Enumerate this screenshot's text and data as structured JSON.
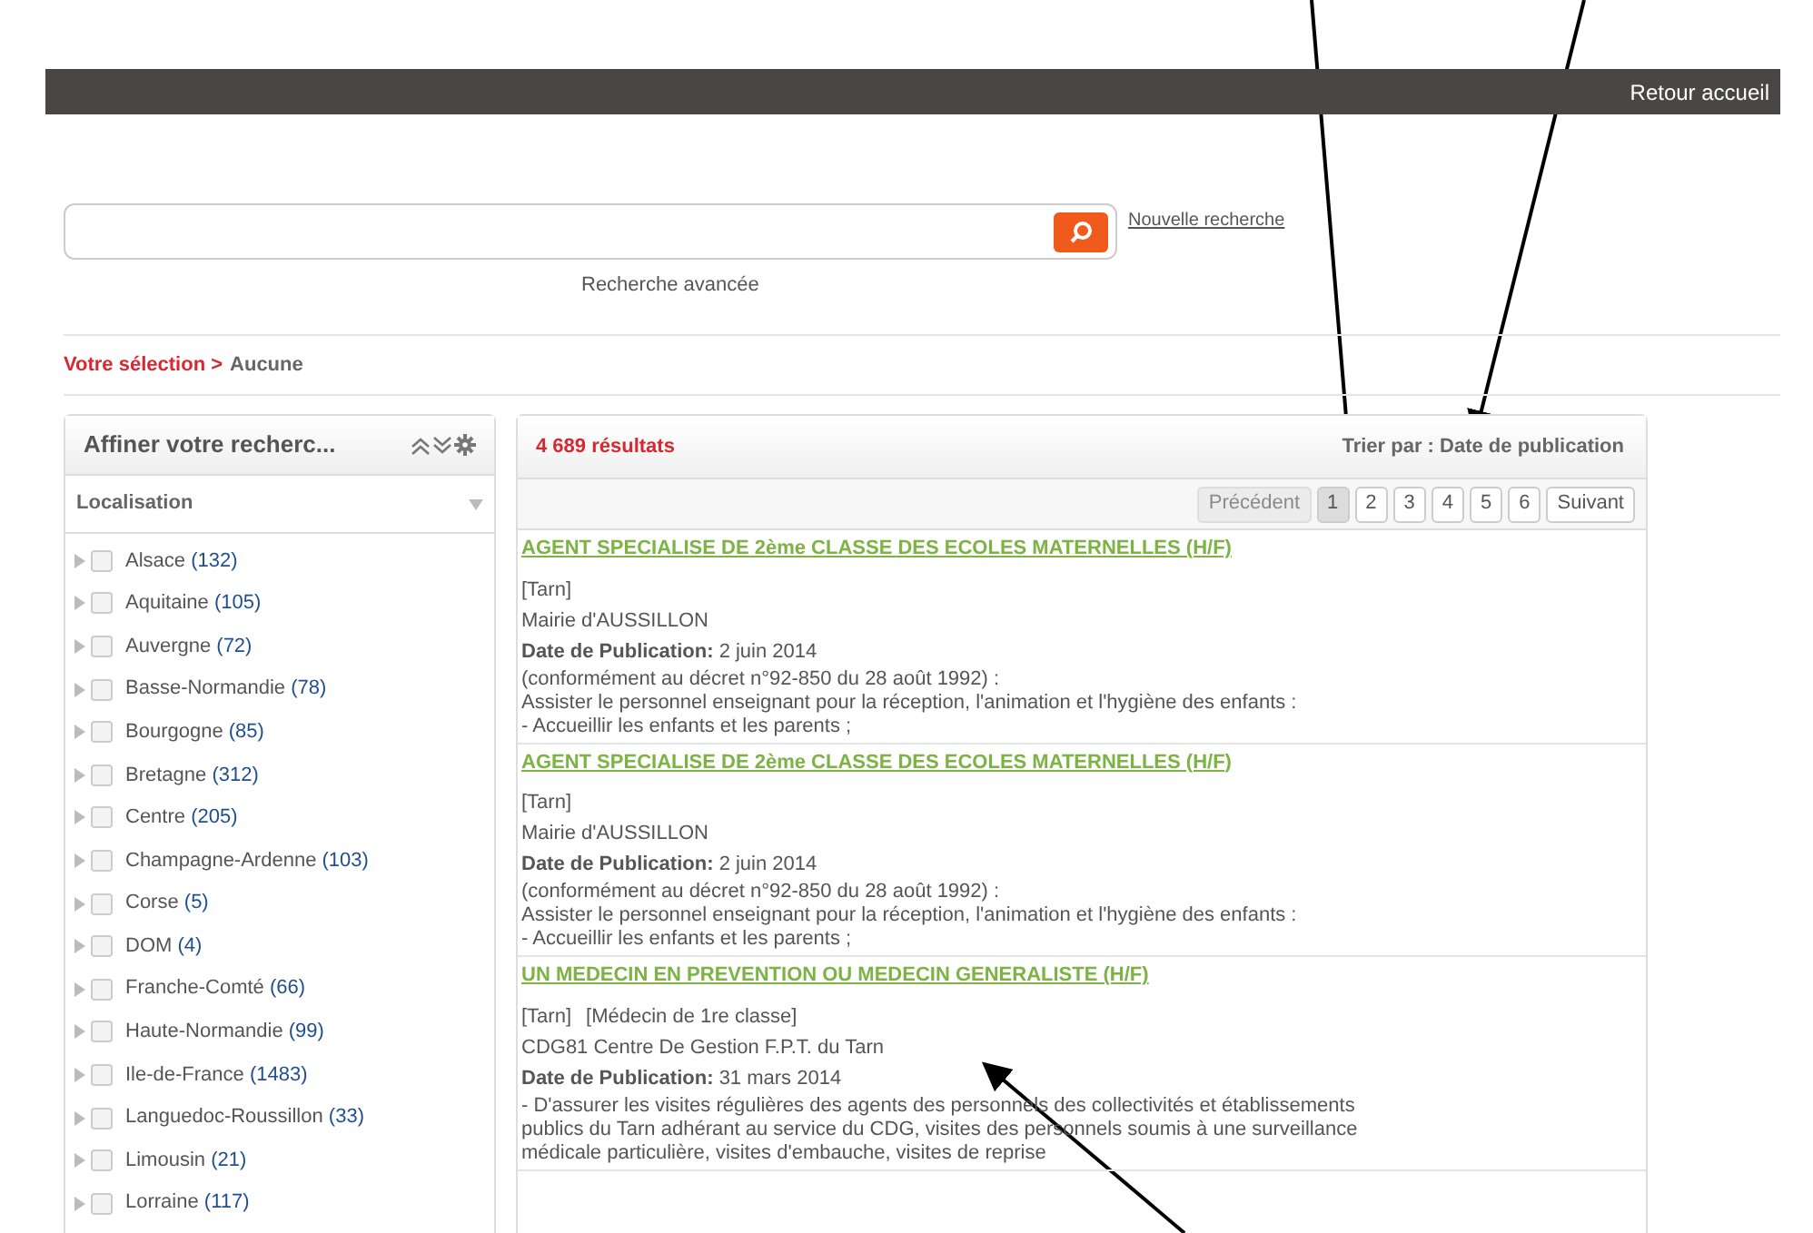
{
  "top_bar": {
    "link": "Retour accueil"
  },
  "search": {
    "new_search": "Nouvelle recherche",
    "advanced": "Recherche avancée"
  },
  "breadcrumb": {
    "label": "Votre sélection >",
    "value": "Aucune"
  },
  "sidebar": {
    "title": "Affiner votre recherc...",
    "section": "Localisation",
    "items": [
      {
        "name": "Alsace",
        "count": "(132)",
        "checked": false
      },
      {
        "name": "Aquitaine",
        "count": "(105)",
        "checked": false
      },
      {
        "name": "Auvergne",
        "count": "(72)",
        "checked": false
      },
      {
        "name": "Basse-Normandie",
        "count": "(78)",
        "checked": false
      },
      {
        "name": "Bourgogne",
        "count": "(85)",
        "checked": false
      },
      {
        "name": "Bretagne",
        "count": "(312)",
        "checked": false
      },
      {
        "name": "Centre",
        "count": "(205)",
        "checked": false
      },
      {
        "name": "Champagne-Ardenne",
        "count": "(103)",
        "checked": false
      },
      {
        "name": "Corse",
        "count": "(5)",
        "checked": false
      },
      {
        "name": "DOM",
        "count": "(4)",
        "checked": false
      },
      {
        "name": "Franche-Comté",
        "count": "(66)",
        "checked": false
      },
      {
        "name": "Haute-Normandie",
        "count": "(99)",
        "checked": false
      },
      {
        "name": "Ile-de-France",
        "count": "(1483)",
        "checked": false
      },
      {
        "name": "Languedoc-Roussillon",
        "count": "(33)",
        "checked": false
      },
      {
        "name": "Limousin",
        "count": "(21)",
        "checked": false
      },
      {
        "name": "Lorraine",
        "count": "(117)",
        "checked": false
      }
    ]
  },
  "results": {
    "count": "4 689 résultats",
    "sort_label": "Trier par :",
    "sort_value": "Date de publication",
    "pagination": [
      {
        "label": "Précédent",
        "selected": false,
        "disabled": true
      },
      {
        "label": "1",
        "selected": true,
        "disabled": false
      },
      {
        "label": "2",
        "selected": false,
        "disabled": false
      },
      {
        "label": "3",
        "selected": false,
        "disabled": false
      },
      {
        "label": "4",
        "selected": false,
        "disabled": false
      },
      {
        "label": "5",
        "selected": false,
        "disabled": false
      },
      {
        "label": "6",
        "selected": false,
        "disabled": false
      },
      {
        "label": "Suivant",
        "selected": false,
        "disabled": false
      }
    ],
    "items": [
      {
        "title": "AGENT SPECIALISE DE 2ème CLASSE DES ECOLES MATERNELLES (H/F)",
        "tags": [
          "[Tarn]"
        ],
        "employer": "Mairie d'AUSSILLON",
        "date_label": "Date de Publication:",
        "date": "2 juin 2014",
        "description": [
          "(conformément au décret n°92-850 du 28 août 1992) :",
          "Assister le personnel enseignant pour la réception, l'animation et l'hygiène des enfants :",
          "- Accueillir les enfants et les parents ;"
        ]
      },
      {
        "title": "AGENT SPECIALISE DE 2ème CLASSE DES ECOLES MATERNELLES (H/F)",
        "tags": [
          "[Tarn]"
        ],
        "employer": "Mairie d'AUSSILLON",
        "date_label": "Date de Publication:",
        "date": "2 juin 2014",
        "description": [
          "(conformément au décret n°92-850 du 28 août 1992) :",
          "Assister le personnel enseignant pour la réception, l'animation et l'hygiène des enfants :",
          "- Accueillir les enfants et les parents ;"
        ]
      },
      {
        "title": "UN MEDECIN EN PREVENTION OU MEDECIN GENERALISTE (H/F)",
        "tags": [
          "[Tarn]",
          "[Médecin de 1re classe]"
        ],
        "employer": "CDG81 Centre De Gestion F.P.T. du Tarn",
        "date_label": "Date de Publication:",
        "date": "31 mars 2014",
        "description": [
          "- D'assurer les visites régulières des agents des personnels des collectivités et établissements publics du Tarn adhérant au service du CDG, visites des personnels soumis à une surveillance médicale particulière, visites d'embauche, visites de reprise"
        ]
      }
    ]
  }
}
